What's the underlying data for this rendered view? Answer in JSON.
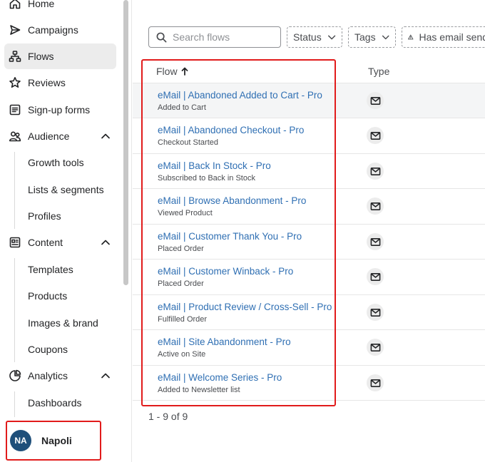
{
  "sidebar": {
    "items": [
      {
        "label": "Home",
        "icon": "home-icon"
      },
      {
        "label": "Campaigns",
        "icon": "send-icon"
      },
      {
        "label": "Flows",
        "icon": "flows-icon",
        "active": true
      },
      {
        "label": "Reviews",
        "icon": "star-icon"
      },
      {
        "label": "Sign-up forms",
        "icon": "form-icon"
      },
      {
        "label": "Audience",
        "icon": "people-icon",
        "expanded": true
      },
      {
        "label": "Content",
        "icon": "content-icon",
        "expanded": true
      },
      {
        "label": "Analytics",
        "icon": "analytics-icon",
        "expanded": true
      }
    ],
    "audience_sub": [
      "Growth tools",
      "Lists & segments",
      "Profiles"
    ],
    "content_sub": [
      "Templates",
      "Products",
      "Images & brand",
      "Coupons"
    ],
    "analytics_sub": [
      "Dashboards"
    ],
    "user": {
      "initials": "NA",
      "name": "Napoli"
    }
  },
  "filters": {
    "search_placeholder": "Search flows",
    "status_label": "Status",
    "tags_label": "Tags",
    "has_email_label": "Has email send"
  },
  "table": {
    "columns": {
      "flow": "Flow",
      "type": "Type"
    },
    "rows": [
      {
        "title": "eMail | Abandoned Added to Cart - Pro",
        "trigger": "Added to Cart",
        "type_icon": "mail-icon"
      },
      {
        "title": "eMail | Abandoned Checkout - Pro",
        "trigger": "Checkout Started",
        "type_icon": "mail-icon"
      },
      {
        "title": "eMail | Back In Stock - Pro",
        "trigger": "Subscribed to Back in Stock",
        "type_icon": "mail-icon"
      },
      {
        "title": "eMail | Browse Abandonment - Pro",
        "trigger": "Viewed Product",
        "type_icon": "mail-icon"
      },
      {
        "title": "eMail | Customer Thank You - Pro",
        "trigger": "Placed Order",
        "type_icon": "mail-icon"
      },
      {
        "title": "eMail | Customer Winback - Pro",
        "trigger": "Placed Order",
        "type_icon": "mail-icon"
      },
      {
        "title": "eMail | Product Review / Cross-Sell - Pro",
        "trigger": "Fulfilled Order",
        "type_icon": "mail-icon"
      },
      {
        "title": "eMail | Site Abandonment - Pro",
        "trigger": "Active on Site",
        "type_icon": "mail-icon"
      },
      {
        "title": "eMail | Welcome Series - Pro",
        "trigger": "Added to Newsletter list",
        "type_icon": "mail-icon"
      }
    ]
  },
  "pagination": {
    "text": "1 - 9 of 9"
  },
  "colors": {
    "link": "#2f6fb3",
    "highlight": "#e11b1b",
    "avatar": "#1f4f7a"
  }
}
